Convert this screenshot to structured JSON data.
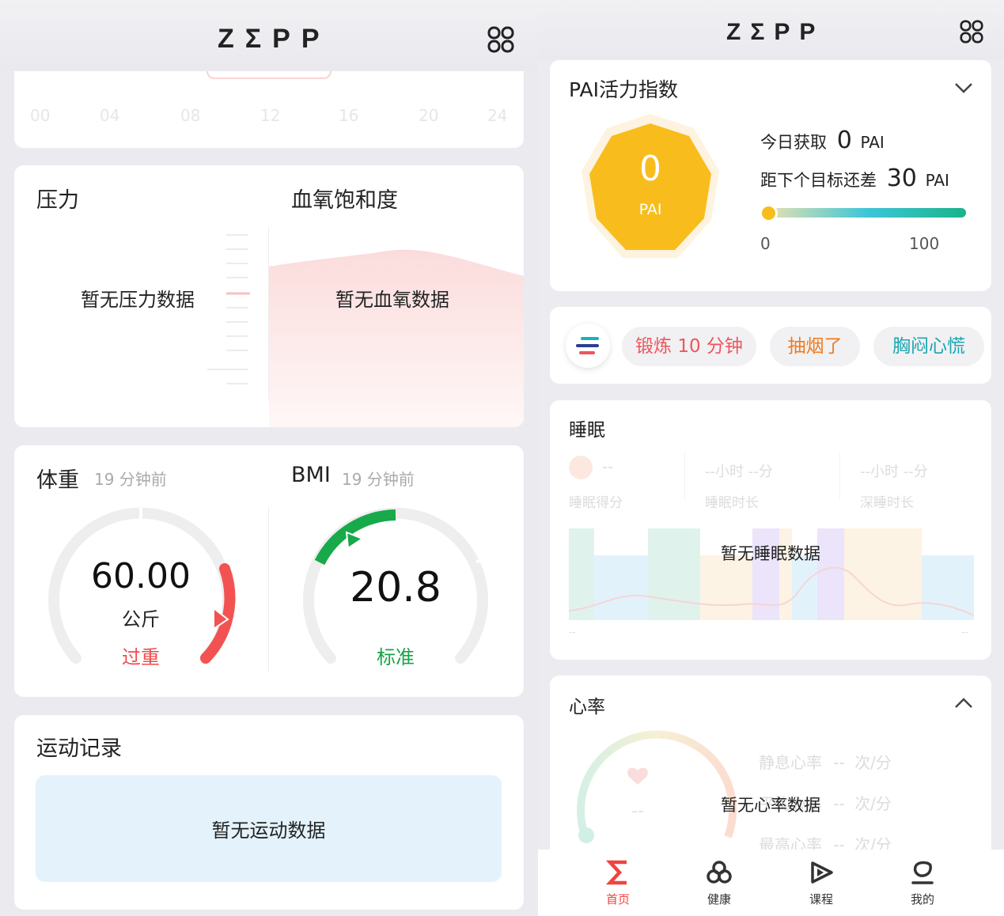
{
  "left": {
    "header": {
      "logo": "ZΣPP",
      "menu_icon": "apps-grid-icon"
    },
    "activity_hours": [
      "00",
      "04",
      "08",
      "12",
      "16",
      "20",
      "24"
    ],
    "stress": {
      "title": "压力",
      "empty": "暂无压力数据"
    },
    "spo2": {
      "title": "血氧饱和度",
      "empty": "暂无血氧数据"
    },
    "weight": {
      "title": "体重",
      "time": "19 分钟前",
      "value": "60.00",
      "unit": "公斤",
      "status": "过重",
      "status_color": "#f04a4a"
    },
    "bmi": {
      "title": "BMI",
      "time": "19 分钟前",
      "value": "20.8",
      "status": "标准",
      "status_color": "#1aa34a"
    },
    "workout": {
      "title": "运动记录",
      "empty": "暂无运动数据"
    }
  },
  "right": {
    "header": {
      "logo": "ZΣPP",
      "menu_icon": "apps-grid-icon"
    },
    "pai": {
      "title": "PAI活力指数",
      "badge_value": "0",
      "badge_unit": "PAI",
      "today_label": "今日获取",
      "today_value": "0",
      "today_unit": "PAI",
      "goal_label": "距下个目标还差",
      "goal_value": "30",
      "goal_unit": "PAI",
      "progress_min": "0",
      "progress_max": "100",
      "progress_value": 0
    },
    "quick_tags": [
      {
        "label": "锻炼 10 分钟",
        "color": "#f0555c"
      },
      {
        "label": "抽烟了",
        "color": "#f07a1f"
      },
      {
        "label": "胸闷心慌",
        "color": "#1aa6b0"
      }
    ],
    "sleep": {
      "title": "睡眠",
      "score_value": "--",
      "score_label": "睡眠得分",
      "duration_value": "--小时 --分",
      "duration_label": "睡眠时长",
      "deep_value": "--小时 --分",
      "deep_label": "深睡时长",
      "empty": "暂无睡眠数据",
      "axis_start": "--",
      "axis_end": "--"
    },
    "heart": {
      "title": "心率",
      "center_value": "--",
      "empty": "暂无心率数据",
      "rows": [
        {
          "label": "静息心率",
          "value": "--",
          "unit": "次/分"
        },
        {
          "label": "平均心率",
          "value": "--",
          "unit": "次/分"
        },
        {
          "label": "最高心率",
          "value": "--",
          "unit": "次/分"
        }
      ]
    },
    "nav": [
      {
        "label": "首页",
        "icon": "sigma-home-icon",
        "active": true
      },
      {
        "label": "健康",
        "icon": "health-icon",
        "active": false
      },
      {
        "label": "课程",
        "icon": "course-play-icon",
        "active": false
      },
      {
        "label": "我的",
        "icon": "profile-icon",
        "active": false
      }
    ]
  }
}
